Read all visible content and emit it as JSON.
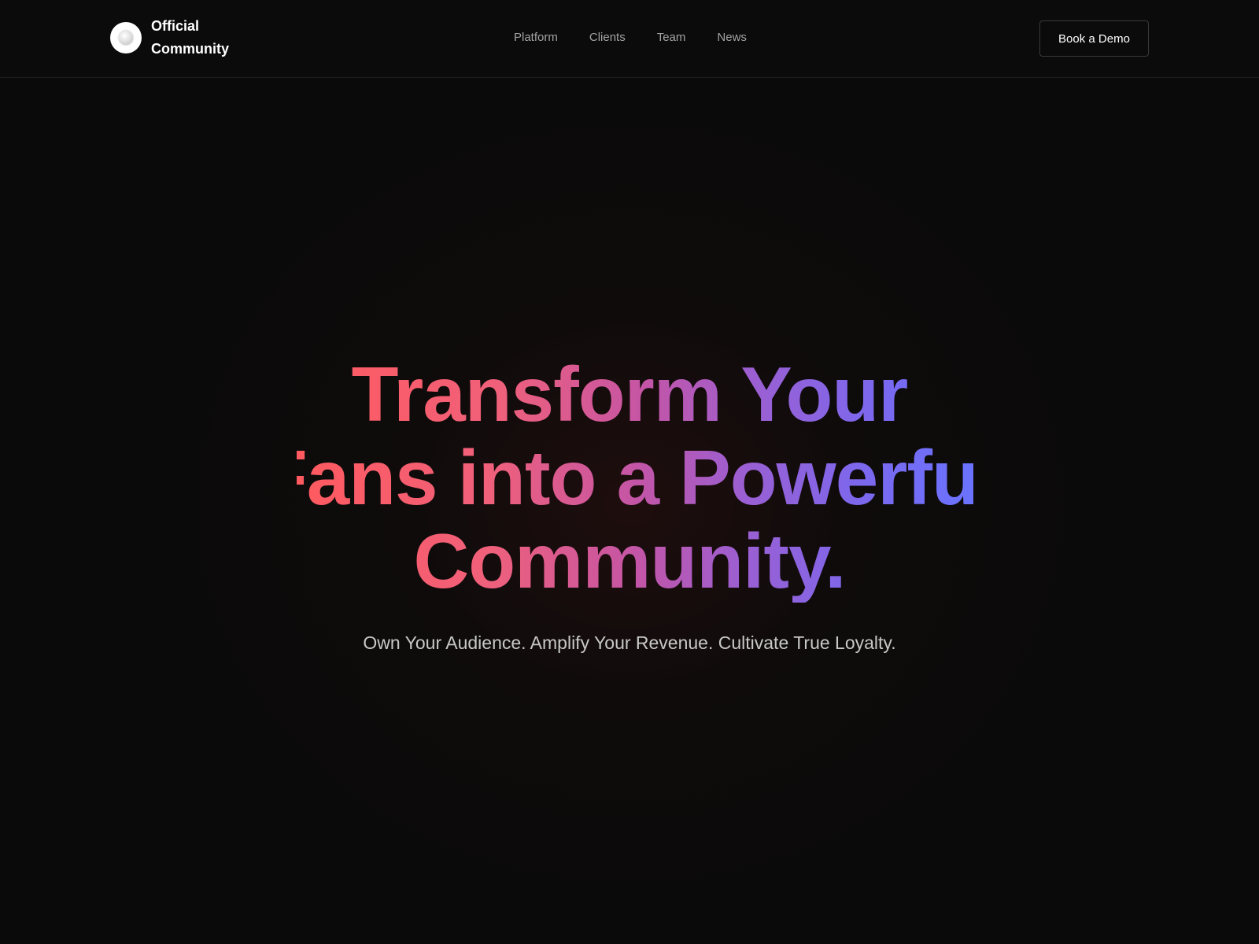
{
  "brand": {
    "logo_icon": "circle-logo-icon",
    "line1": "Official",
    "line2": "Community"
  },
  "nav": {
    "items": [
      {
        "label": "Platform"
      },
      {
        "label": "Clients"
      },
      {
        "label": "Team"
      },
      {
        "label": "News"
      }
    ]
  },
  "header": {
    "cta_label": "Book a Demo"
  },
  "hero": {
    "title_lines": [
      "Transform Your",
      "Fans into a Powerful",
      "Community."
    ],
    "subtitle": "Own Your Audience. Amplify Your Revenue. Cultivate True Loyalty."
  },
  "colors": {
    "background": "#0a0a0a",
    "gradient_start": "#ff5a5f",
    "gradient_mid": "#c455a6",
    "gradient_end": "#6a73ff",
    "nav_text": "#a3a3a3",
    "subtitle_text": "#c8c8c8"
  }
}
